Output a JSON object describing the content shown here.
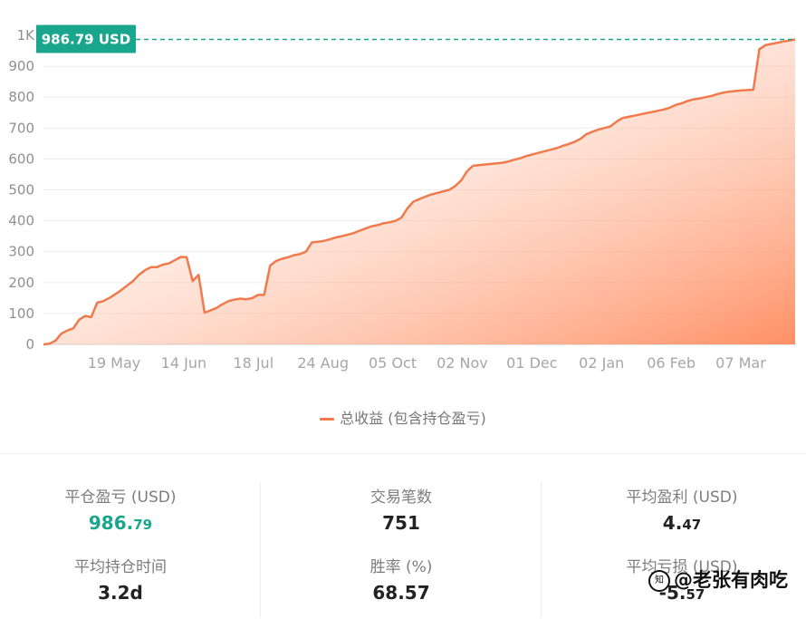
{
  "chart_data": {
    "type": "area",
    "title": "",
    "xlabel": "",
    "ylabel": "",
    "ylim": [
      0,
      1000
    ],
    "yticks": [
      "0",
      "100",
      "200",
      "300",
      "400",
      "500",
      "600",
      "700",
      "800",
      "900",
      "1K"
    ],
    "xticks": [
      "19 May",
      "14 Jun",
      "18 Jul",
      "24 Aug",
      "05 Oct",
      "02 Nov",
      "01 Dec",
      "02 Jan",
      "06 Feb",
      "07 Mar"
    ],
    "last_value_label": "986.79 USD",
    "series": [
      {
        "name": "总收益 (包含持仓盈亏)",
        "color": "#f07a4c",
        "values": [
          0,
          2,
          12,
          35,
          45,
          52,
          80,
          92,
          88,
          135,
          140,
          150,
          162,
          175,
          190,
          205,
          225,
          240,
          250,
          250,
          258,
          262,
          272,
          283,
          282,
          205,
          225,
          103,
          110,
          118,
          130,
          140,
          145,
          148,
          146,
          150,
          160,
          160,
          255,
          270,
          277,
          282,
          289,
          292,
          300,
          330,
          332,
          335,
          340,
          346,
          350,
          355,
          360,
          368,
          375,
          382,
          386,
          392,
          395,
          400,
          410,
          440,
          462,
          470,
          478,
          485,
          490,
          495,
          500,
          512,
          530,
          560,
          578,
          580,
          582,
          584,
          586,
          588,
          592,
          598,
          603,
          610,
          615,
          620,
          625,
          630,
          635,
          642,
          648,
          655,
          665,
          680,
          688,
          695,
          700,
          705,
          720,
          732,
          736,
          740,
          744,
          748,
          752,
          756,
          760,
          766,
          775,
          780,
          788,
          793,
          796,
          800,
          804,
          810,
          815,
          818,
          820,
          822,
          823,
          824,
          955,
          968,
          972,
          976,
          980,
          983,
          986.79
        ]
      }
    ]
  },
  "legend": {
    "label": "总收益 (包含持仓盈亏)"
  },
  "stats": {
    "realized_pnl": {
      "label": "平仓盈亏 (USD)",
      "value_main": "986.",
      "value_small": "79"
    },
    "trade_count": {
      "label": "交易笔数",
      "value": "751"
    },
    "avg_profit": {
      "label": "平均盈利 (USD)",
      "value_main": "4.",
      "value_small": "47"
    },
    "avg_hold_time": {
      "label": "平均持仓时间",
      "value": "3.2d"
    },
    "win_rate": {
      "label": "胜率 (%)",
      "value": "68.57"
    },
    "avg_loss": {
      "label": "平均亏损 (USD)",
      "value_main": "-5.",
      "value_small": "57"
    }
  },
  "watermark": {
    "text": "@老张有肉吃",
    "logo": "知"
  },
  "colors": {
    "line": "#f07a4c",
    "area_top": "#ff8a5c",
    "accent_green": "#1aa68c",
    "dashed": "#1aa68c"
  }
}
